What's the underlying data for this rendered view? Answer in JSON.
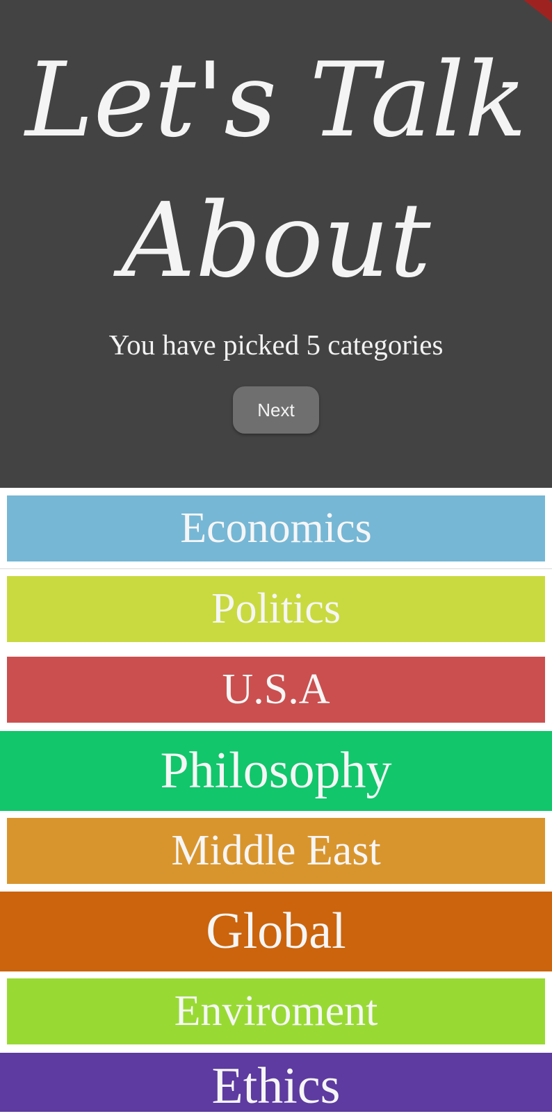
{
  "header": {
    "title_line1": "Let's Talk",
    "title_line2": "About",
    "status": "You have picked 5 categories",
    "next_label": "Next"
  },
  "categories": [
    {
      "label": "Economics",
      "color": "#76b7d5",
      "selected": false
    },
    {
      "label": "Politics",
      "color": "#c9da40",
      "selected": false
    },
    {
      "label": "U.S.A",
      "color": "#cb4f4f",
      "selected": false
    },
    {
      "label": "Philosophy",
      "color": "#11c66b",
      "selected": true
    },
    {
      "label": "Middle East",
      "color": "#d9952d",
      "selected": false
    },
    {
      "label": "Global",
      "color": "#cb640d",
      "selected": true
    },
    {
      "label": "Enviroment",
      "color": "#98da33",
      "selected": false
    },
    {
      "label": "Ethics",
      "color": "#5d3ba0",
      "selected": true
    }
  ]
}
